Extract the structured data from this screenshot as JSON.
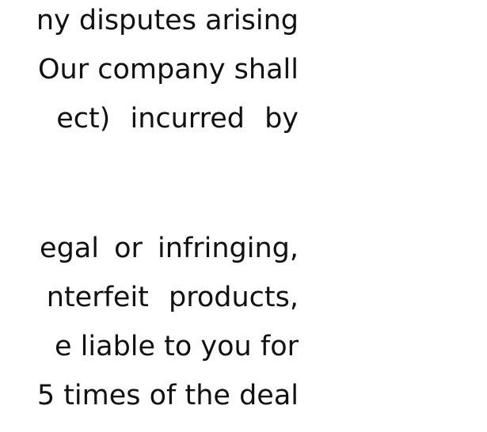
{
  "paragraph_1": {
    "lines": [
      "ny disputes arising",
      "Our company shall",
      "ect)   incurred by"
    ]
  },
  "paragraph_2": {
    "lines": [
      "egal or infringing,",
      "nterfeit  products,",
      "e liable to you for",
      "5 times of the deal"
    ]
  }
}
